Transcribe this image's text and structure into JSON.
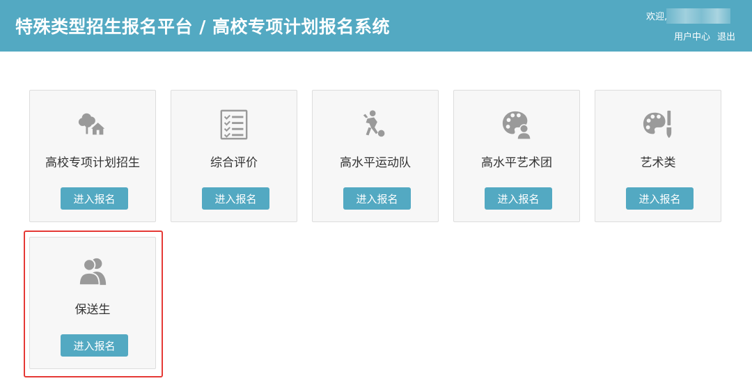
{
  "header": {
    "title": "特殊类型招生报名平台 / 高校专项计划报名系统",
    "welcome": "欢迎,",
    "links": [
      "用户中心",
      "退出"
    ],
    "bg_color": "#53a9c2"
  },
  "cards": [
    {
      "title": "高校专项计划招生",
      "button": "进入报名",
      "icon": "tree-house-icon"
    },
    {
      "title": "综合评价",
      "button": "进入报名",
      "icon": "checklist-icon"
    },
    {
      "title": "高水平运动队",
      "button": "进入报名",
      "icon": "soccer-player-icon"
    },
    {
      "title": "高水平艺术团",
      "button": "进入报名",
      "icon": "palette-person-icon"
    },
    {
      "title": "艺术类",
      "button": "进入报名",
      "icon": "palette-brush-icon"
    },
    {
      "title": "保送生",
      "button": "进入报名",
      "icon": "users-icon"
    }
  ],
  "colors": {
    "accent": "#53a9c2",
    "card_bg": "#f7f7f7",
    "highlight": "#e53935",
    "icon": "#9a9a9a"
  }
}
